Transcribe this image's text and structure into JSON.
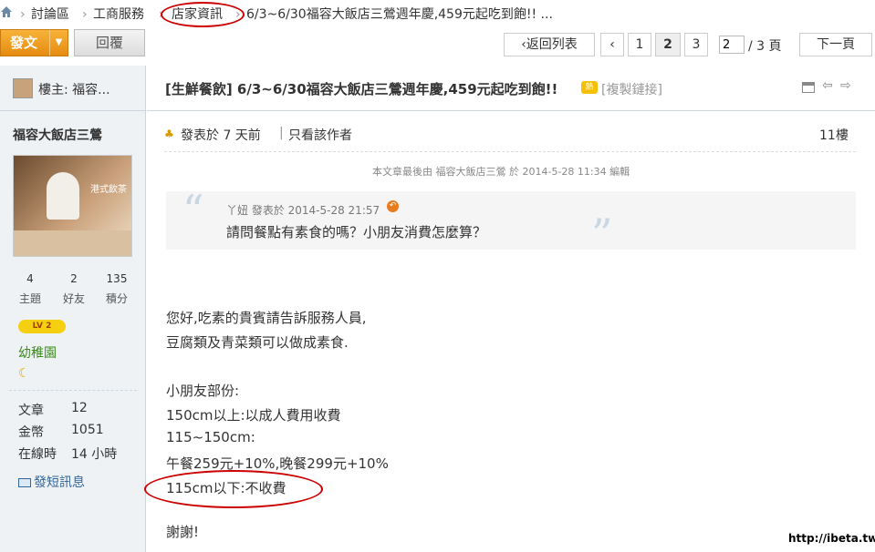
{
  "breadcrumb": {
    "forum": "討論區",
    "section": "工商服務",
    "subsection": "店家資訊",
    "thread": "6/3~6/30福容大飯店三鶯週年慶,459元起吃到飽!! ..."
  },
  "toolbar": {
    "post_label": "發文",
    "reply_label": "回覆"
  },
  "pagination": {
    "back_label": "返回列表",
    "pages": [
      "1",
      "2",
      "3"
    ],
    "current_page": "2",
    "page_input": "2",
    "total_label": "/ 3 頁",
    "next_label": "下一頁"
  },
  "sidebar": {
    "op_label": "樓主: 福容...",
    "username": "福容大飯店三鶯",
    "avatar_text": "港式飲茶",
    "stats": [
      {
        "value": "4",
        "label": "主題"
      },
      {
        "value": "2",
        "label": "好友"
      },
      {
        "value": "135",
        "label": "積分"
      }
    ],
    "level_badge": "LV 2",
    "rank": "幼稚園",
    "info": [
      {
        "label": "文章",
        "value": "12"
      },
      {
        "label": "金幣",
        "value": "1051"
      },
      {
        "label": "在線時",
        "value": "14 小時"
      }
    ],
    "message_label": "發短訊息"
  },
  "thread": {
    "title": "[生鮮餐飲] 6/3~6/30福容大飯店三鶯週年慶,459元起吃到飽!!",
    "copy_link": "[複製鏈接]"
  },
  "post": {
    "posted": "發表於 7 天前",
    "author_only": "只看該作者",
    "floor": "11樓",
    "edit_note": "本文章最後由 福容大飯店三鶯 於 2014-5-28 11:34 編輯",
    "quote_meta": "丫妞 發表於 2014-5-28 21:57",
    "quote_text": "請問餐點有素食的嗎？小朋友消費怎麼算？",
    "body": [
      "您好,吃素的貴賓請告訴服務人員,",
      "豆腐類及青菜類可以做成素食.",
      "小朋友部份:",
      "150cm以上:以成人費用收費",
      "115~150cm:",
      "午餐259元+10%,晚餐299元+10%",
      "115cm以下:不收費",
      "謝謝!"
    ]
  },
  "watermark": "http://ibeta.tw",
  "colors": {
    "accent_orange": "#f0a020",
    "highlight_red": "#cc0000",
    "sidebar_bg": "#eef2f5"
  }
}
